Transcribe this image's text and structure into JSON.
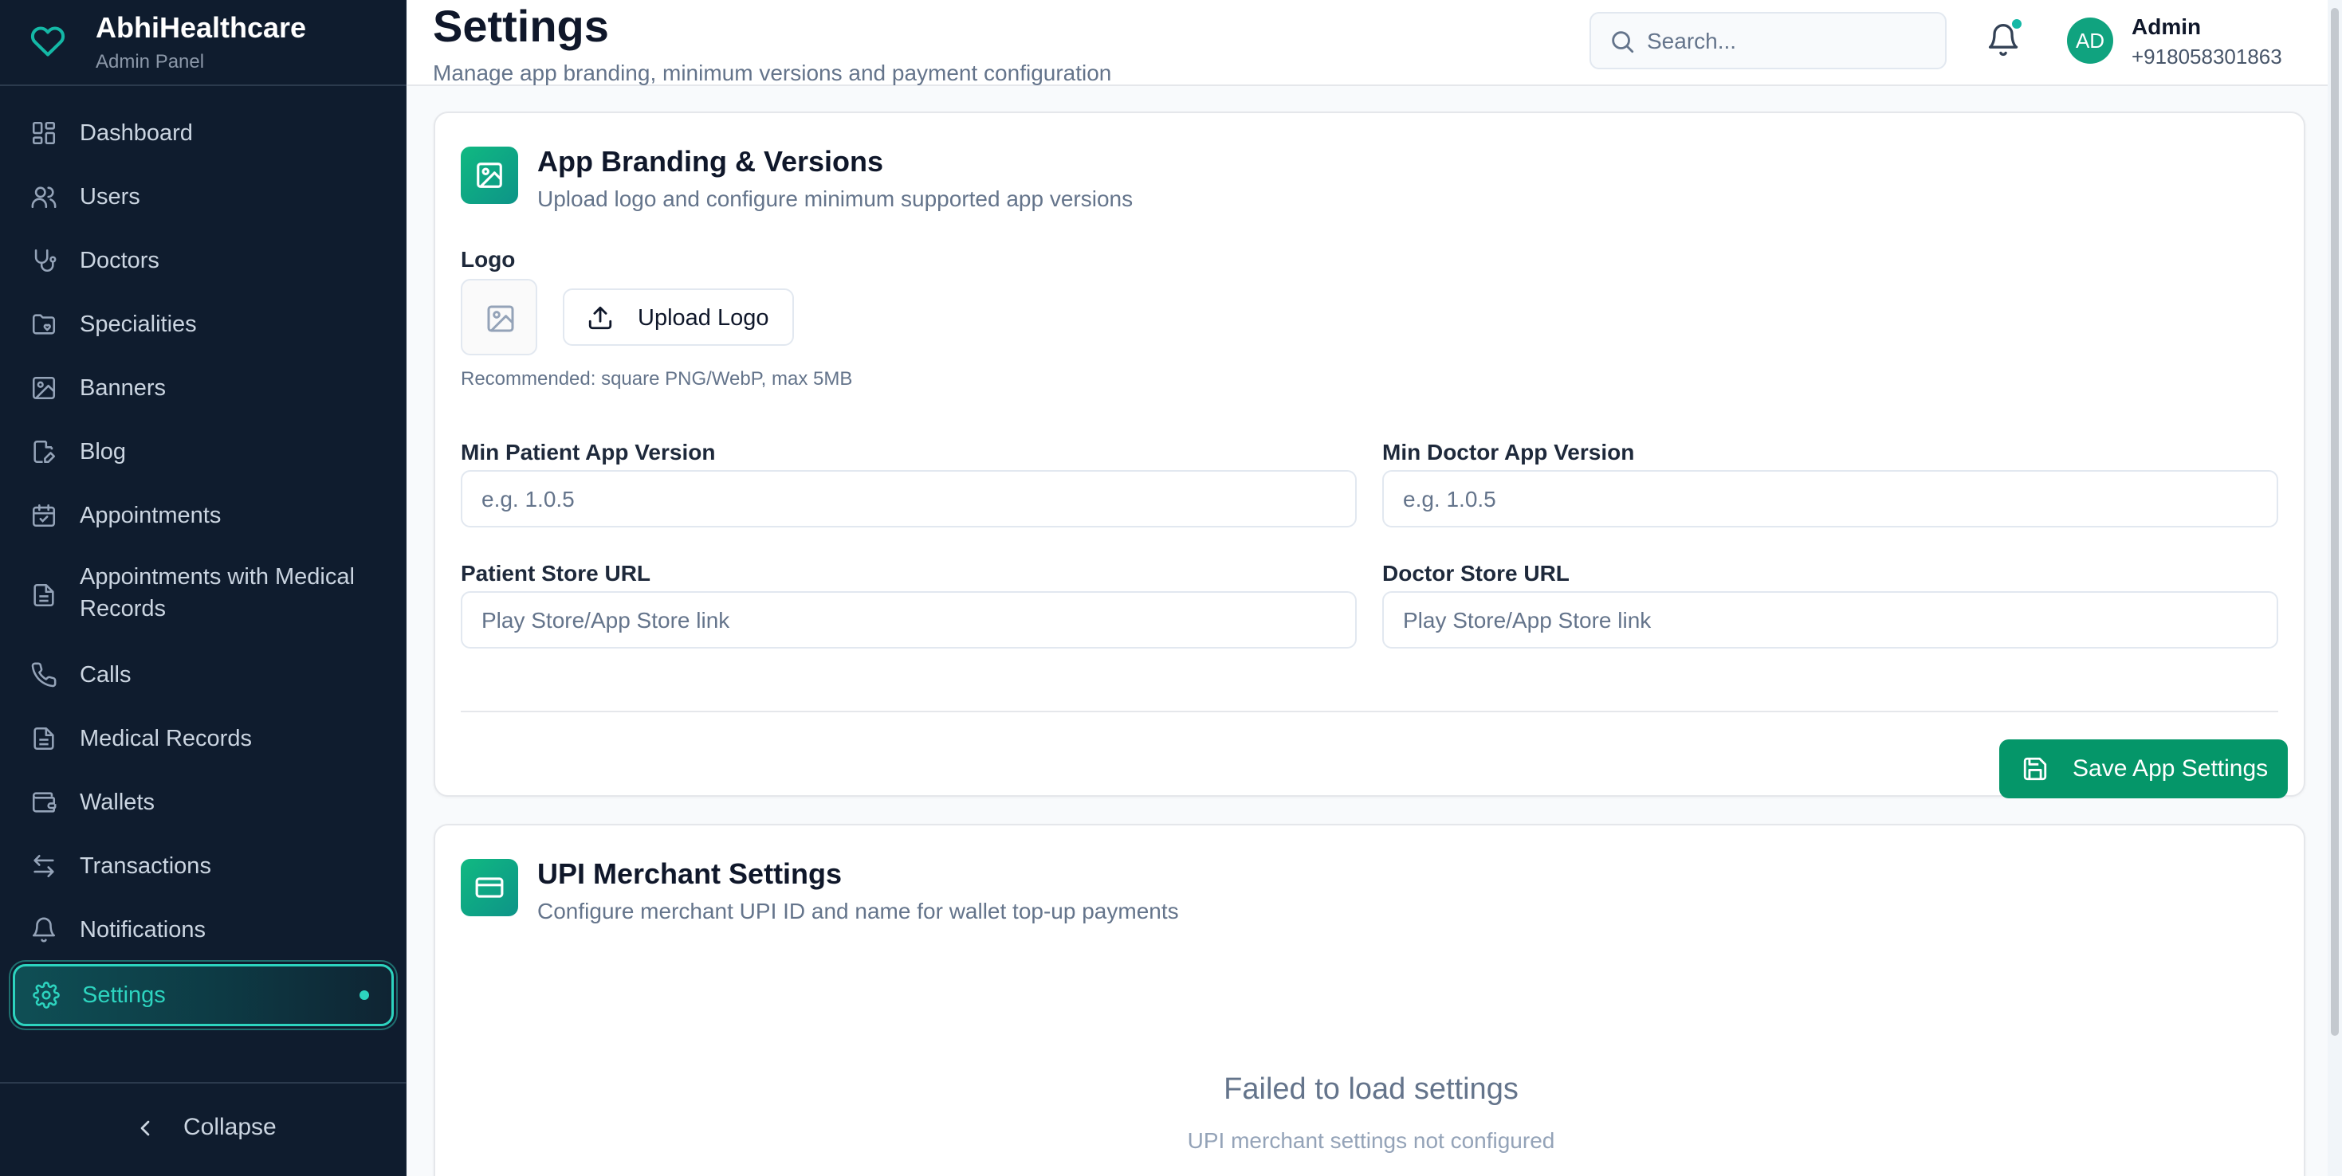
{
  "brand": {
    "title": "AbhiHealthcare",
    "subtitle": "Admin Panel"
  },
  "sidebar": {
    "items": [
      {
        "label": "Dashboard",
        "icon": "dashboard-icon"
      },
      {
        "label": "Users",
        "icon": "users-icon"
      },
      {
        "label": "Doctors",
        "icon": "stethoscope-icon"
      },
      {
        "label": "Specialities",
        "icon": "folder-heart-icon"
      },
      {
        "label": "Banners",
        "icon": "image-icon"
      },
      {
        "label": "Blog",
        "icon": "edit-file-icon"
      },
      {
        "label": "Appointments",
        "icon": "calendar-check-icon"
      },
      {
        "label": "Appointments with Medical Records",
        "icon": "file-text-icon"
      },
      {
        "label": "Calls",
        "icon": "phone-icon"
      },
      {
        "label": "Medical Records",
        "icon": "file-text-icon"
      },
      {
        "label": "Wallets",
        "icon": "wallet-icon"
      },
      {
        "label": "Transactions",
        "icon": "arrows-left-right-icon"
      },
      {
        "label": "Notifications",
        "icon": "bell-icon"
      },
      {
        "label": "Settings",
        "icon": "gear-icon",
        "active": true
      }
    ],
    "collapse_label": "Collapse"
  },
  "header": {
    "title": "Settings",
    "subtitle": "Manage app branding, minimum versions and payment configuration",
    "search_placeholder": "Search...",
    "avatar_initials": "AD",
    "user_name": "Admin",
    "user_phone": "+918058301863"
  },
  "branding_card": {
    "title": "App Branding & Versions",
    "subtitle": "Upload logo and configure minimum supported app versions",
    "logo_label": "Logo",
    "upload_label": "Upload Logo",
    "logo_hint": "Recommended: square PNG/WebP, max 5MB",
    "min_patient_label": "Min Patient App Version",
    "min_patient_placeholder": "e.g. 1.0.5",
    "min_doctor_label": "Min Doctor App Version",
    "min_doctor_placeholder": "e.g. 1.0.5",
    "patient_store_label": "Patient Store URL",
    "patient_store_placeholder": "Play Store/App Store link",
    "doctor_store_label": "Doctor Store URL",
    "doctor_store_placeholder": "Play Store/App Store link",
    "save_label": "Save App Settings"
  },
  "upi_card": {
    "title": "UPI Merchant Settings",
    "subtitle": "Configure merchant UPI ID and name for wallet top-up payments",
    "error_title": "Failed to load settings",
    "error_subtitle": "UPI merchant settings not configured"
  },
  "colors": {
    "sidebar_bg": "#0f1c2e",
    "accent": "#14b8a6",
    "primary_button": "#059669"
  }
}
